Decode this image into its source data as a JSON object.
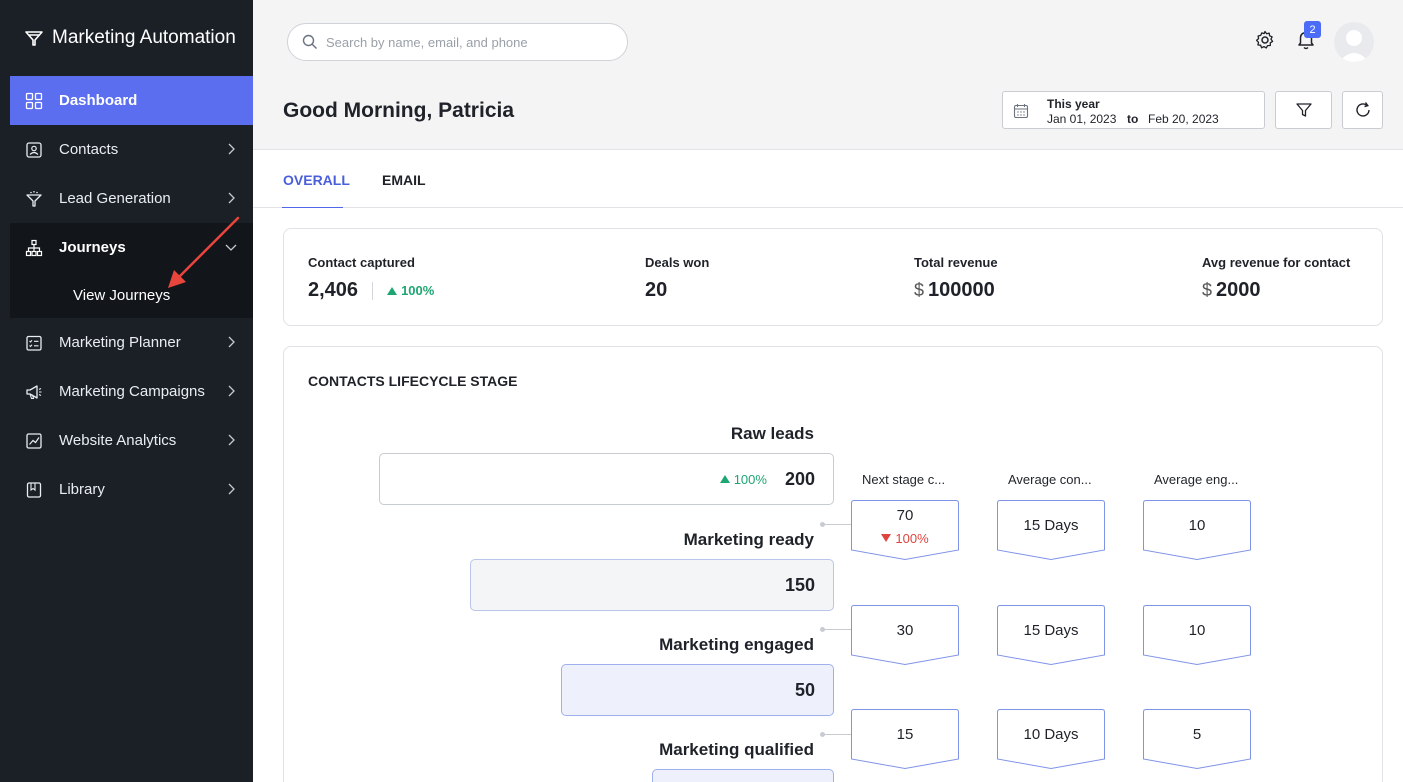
{
  "app": {
    "title": "Marketing Automation"
  },
  "sidebar": {
    "items": [
      {
        "label": "Dashboard",
        "icon": "grid-icon"
      },
      {
        "label": "Contacts",
        "icon": "contacts-icon"
      },
      {
        "label": "Lead Generation",
        "icon": "funnel-icon"
      },
      {
        "label": "Journeys",
        "icon": "hierarchy-icon"
      },
      {
        "label": "Marketing Planner",
        "icon": "checklist-icon"
      },
      {
        "label": "Marketing Campaigns",
        "icon": "megaphone-icon"
      },
      {
        "label": "Website Analytics",
        "icon": "chart-icon"
      },
      {
        "label": "Library",
        "icon": "book-icon"
      }
    ],
    "subitems": [
      {
        "label": "View Journeys"
      }
    ]
  },
  "topbar": {
    "search_placeholder": "Search by name, email, and phone",
    "notification_count": "2"
  },
  "header": {
    "greeting": "Good Morning, Patricia",
    "date_range": {
      "label": "This year",
      "from": "Jan 01, 2023",
      "to_label": "to",
      "to": "Feb 20, 2023"
    }
  },
  "tabs": [
    {
      "label": "OVERALL"
    },
    {
      "label": "EMAIL"
    }
  ],
  "stats": [
    {
      "title": "Contact captured",
      "value": "2,406",
      "change": "100%"
    },
    {
      "title": "Deals won",
      "value": "20"
    },
    {
      "title": "Total revenue",
      "currency": "$",
      "value": "100000"
    },
    {
      "title": "Avg revenue for contact",
      "currency": "$",
      "value": "2000"
    }
  ],
  "lifecycle": {
    "title": "CONTACTS LIFECYCLE STAGE",
    "stages": [
      {
        "label": "Raw leads",
        "value": "200",
        "change": "100%"
      },
      {
        "label": "Marketing ready",
        "value": "150"
      },
      {
        "label": "Marketing engaged",
        "value": "50"
      },
      {
        "label": "Marketing qualified",
        "value": ""
      }
    ],
    "columns": [
      "Next stage c...",
      "Average con...",
      "Average eng..."
    ],
    "rows": [
      {
        "next": "70",
        "next_change": "100%",
        "avg_con": "15 Days",
        "avg_eng": "10"
      },
      {
        "next": "30",
        "avg_con": "15 Days",
        "avg_eng": "10"
      },
      {
        "next": "15",
        "avg_con": "10 Days",
        "avg_eng": "5"
      }
    ]
  },
  "colors": {
    "sidebar_bg": "#1b2027",
    "accent": "#5b6ef0",
    "positive": "#1ea672",
    "negative": "#e0443e",
    "annotation": "#e8453c"
  }
}
